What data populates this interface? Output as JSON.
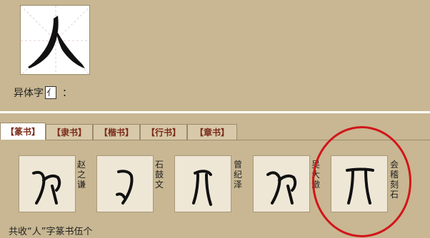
{
  "main_char": {
    "glyph": "人"
  },
  "variant_label": "异体字",
  "variant_char": "亻",
  "variant_colon": "：",
  "tabs": [
    {
      "label": "【篆书】",
      "active": true
    },
    {
      "label": "【隶书】",
      "active": false
    },
    {
      "label": "【楷书】",
      "active": false
    },
    {
      "label": "【行书】",
      "active": false
    },
    {
      "label": "【章书】",
      "active": false
    }
  ],
  "glyphs": [
    {
      "source": "赵之谦"
    },
    {
      "source": "石鼓文"
    },
    {
      "source": "曾纪泽"
    },
    {
      "source": "吴大澂"
    },
    {
      "source": "会稽刻石"
    }
  ],
  "footer": "共收“人”字篆书伍个",
  "colors": {
    "background": "#c8b792",
    "tab_text": "#7a2a18",
    "highlight_circle": "#d2151a"
  }
}
